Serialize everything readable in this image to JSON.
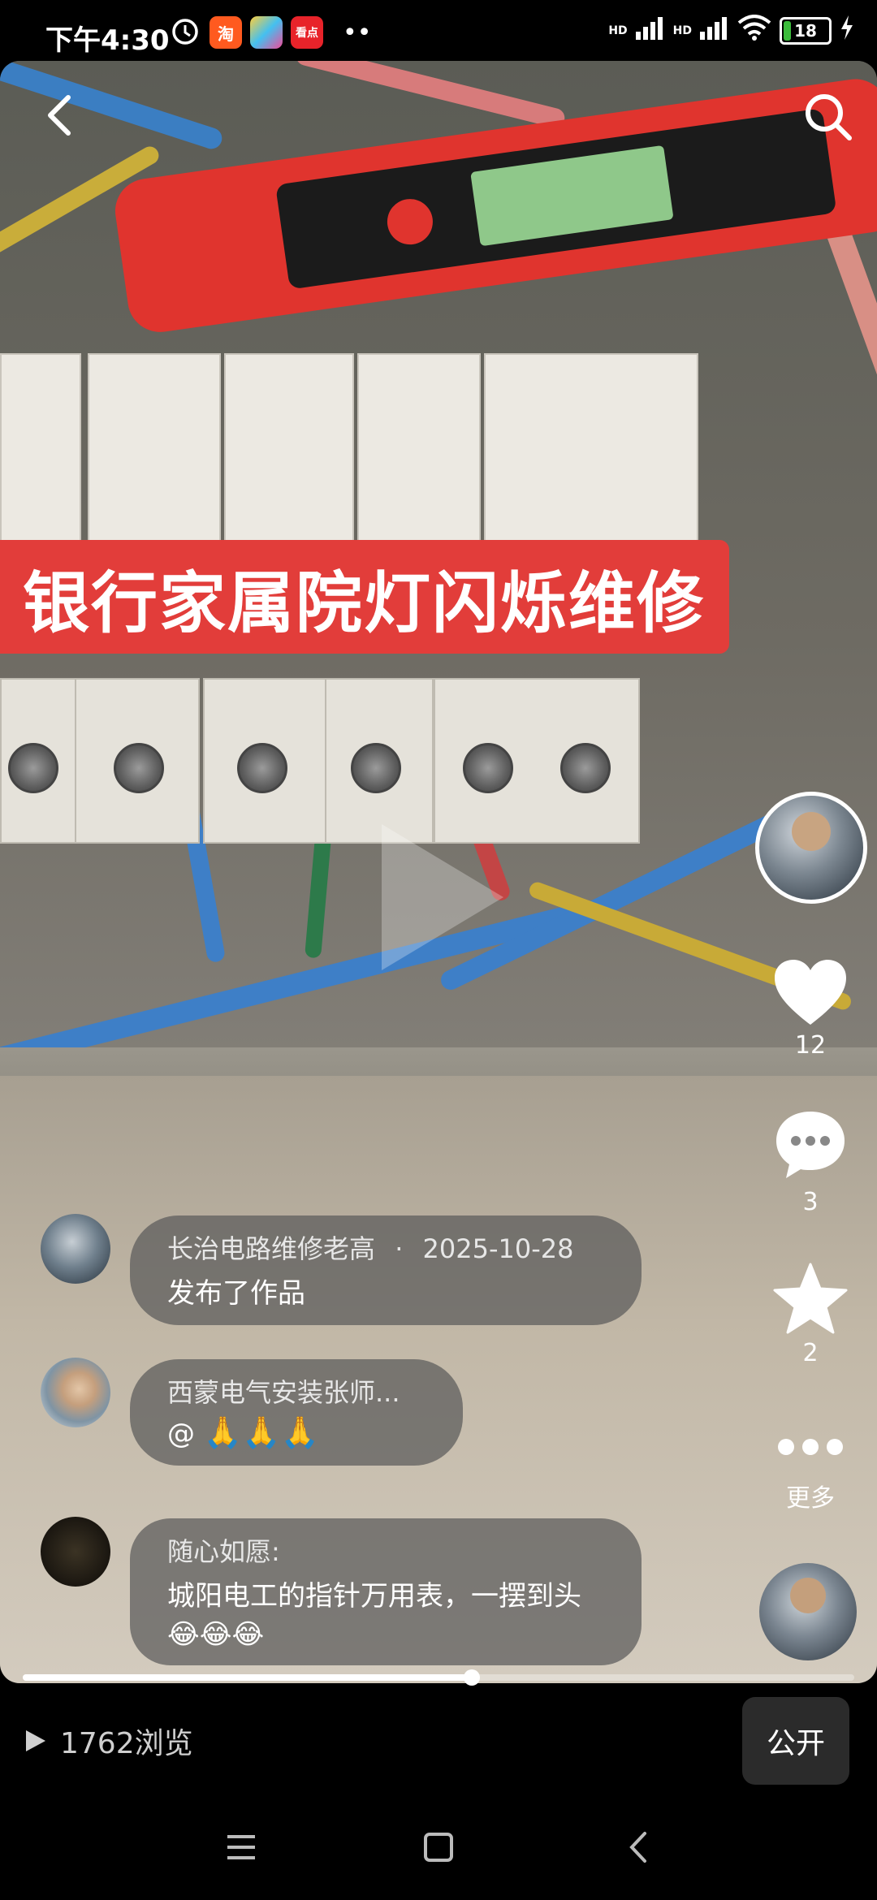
{
  "status_bar": {
    "time": "下午4:30",
    "app_badges": [
      "淘",
      "看点"
    ],
    "dots": "••",
    "network": "HD",
    "battery_level": "18",
    "battery_percent": 18
  },
  "video": {
    "title_banner": "银行家属院灯闪烁维修",
    "progress": 0.54
  },
  "actions": {
    "likes": "12",
    "comments": "3",
    "favorites": "2",
    "more_label": "更多"
  },
  "comments": [
    {
      "name": "长治电路维修老高",
      "separator": "·",
      "date": "2025-10-28",
      "text": "发布了作品"
    },
    {
      "name": "西蒙电气安装张师...",
      "text": "@"
    },
    {
      "name": "随心如愿:",
      "text": "城阳电工的指针万用表，一摆到头"
    }
  ],
  "bottom_bar": {
    "views": "1762浏览",
    "public_label": "公开"
  },
  "icons": [
    "back-icon",
    "search-icon",
    "heart-icon",
    "comment-icon",
    "star-icon",
    "play-icon",
    "menu-icon",
    "home-icon",
    "nav-back-icon"
  ]
}
